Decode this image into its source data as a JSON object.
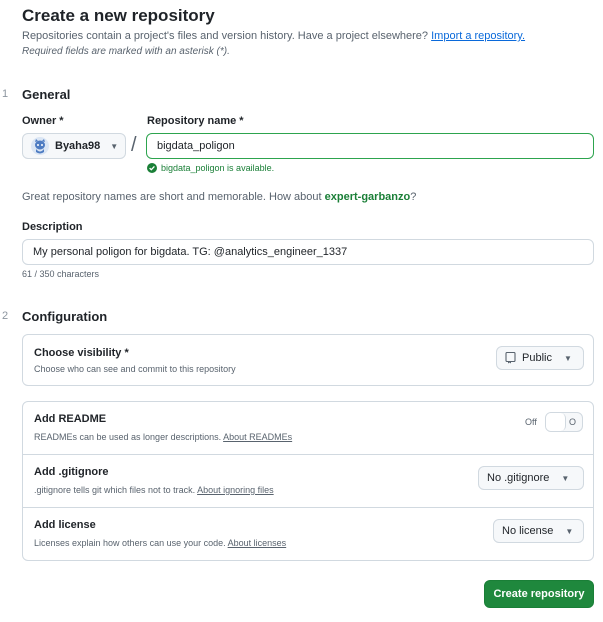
{
  "header": {
    "title": "Create a new repository",
    "subtitle_text": "Repositories contain a project's files and version history. Have a project elsewhere?",
    "import_link": "Import a repository.",
    "required_note": "Required fields are marked with an asterisk (*)."
  },
  "general": {
    "step": "1",
    "title": "General",
    "owner_label": "Owner *",
    "owner_value": "Byaha98",
    "repo_label": "Repository name *",
    "repo_value": "bigdata_poligon",
    "separator": "/",
    "availability": "bigdata_poligon is available.",
    "suggestion_text": "Great repository names are short and memorable. How about",
    "suggestion_name": "expert-garbanzo",
    "suggestion_end": "?",
    "description_label": "Description",
    "description_value": "My personal poligon for bigdata. TG: @analytics_engineer_1337",
    "char_count": "61 / 350 characters"
  },
  "configuration": {
    "step": "2",
    "title": "Configuration",
    "visibility": {
      "title": "Choose visibility *",
      "desc": "Choose who can see and commit to this repository",
      "value": "Public"
    },
    "readme": {
      "title": "Add README",
      "desc": "READMEs can be used as longer descriptions.",
      "link": "About READMEs",
      "toggle_state": "Off",
      "toggle_glyph": "O"
    },
    "gitignore": {
      "title": "Add .gitignore",
      "desc": ".gitignore tells git which files not to track.",
      "link": "About ignoring files",
      "value": "No .gitignore"
    },
    "license": {
      "title": "Add license",
      "desc": "Licenses explain how others can use your code.",
      "link": "About licenses",
      "value": "No license"
    }
  },
  "actions": {
    "create_label": "Create repository"
  },
  "icons": {
    "owner_avatar": "octocat-avatar-icon",
    "available": "check-circle-icon",
    "visibility": "repo-icon",
    "caret": "chevron-down-icon"
  },
  "colors": {
    "primary_green": "#1f883d",
    "success_text": "#1a7f37",
    "link_blue": "#0969da",
    "border": "#d1d9e0",
    "muted_text": "#59636e"
  }
}
